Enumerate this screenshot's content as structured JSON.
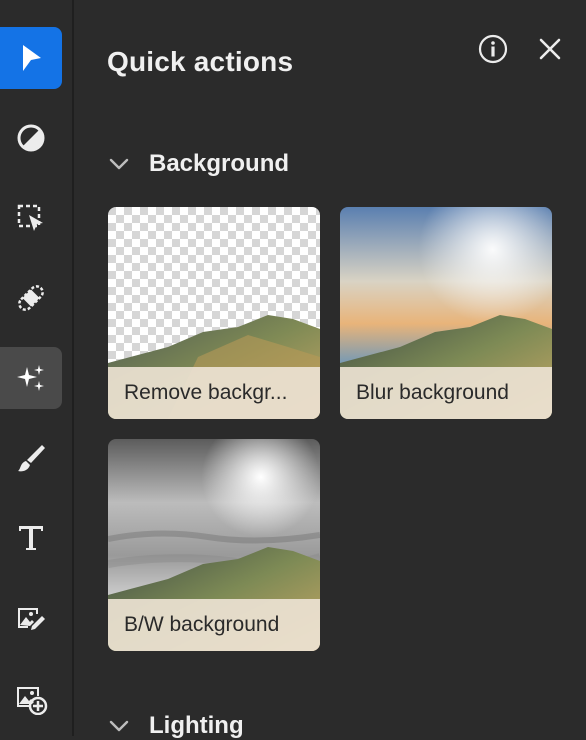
{
  "toolbar": {
    "tools": [
      {
        "name": "select-tool",
        "icon": "arrow-pointer-icon",
        "state": "active"
      },
      {
        "name": "adjust-tool",
        "icon": "half-circle-icon"
      },
      {
        "name": "selection-tool",
        "icon": "marquee-select-icon"
      },
      {
        "name": "heal-tool",
        "icon": "bandage-icon"
      },
      {
        "name": "quick-actions-tool",
        "icon": "sparkles-icon",
        "state": "selected"
      },
      {
        "name": "brush-tool",
        "icon": "brush-icon"
      },
      {
        "name": "text-tool",
        "icon": "text-t-icon"
      },
      {
        "name": "edit-image-tool",
        "icon": "image-edit-icon"
      },
      {
        "name": "add-image-tool",
        "icon": "image-add-icon"
      }
    ],
    "accent": "#1473e6"
  },
  "panel": {
    "title": "Quick actions",
    "info_icon": "info-icon",
    "close_icon": "close-icon"
  },
  "sections": [
    {
      "label": "Background",
      "expanded": true,
      "cards": [
        {
          "label": "Remove backgr...",
          "thumb": "transparent-checker-mountain"
        },
        {
          "label": "Blur background",
          "thumb": "blurred-sky-mountain"
        },
        {
          "label": "B/W background",
          "thumb": "grayscale-sky-mountain"
        }
      ]
    },
    {
      "label": "Lighting",
      "expanded": true
    }
  ]
}
